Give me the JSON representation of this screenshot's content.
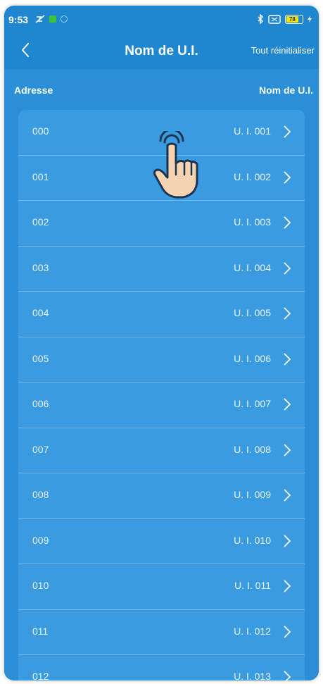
{
  "status_bar": {
    "time": "9:53",
    "battery": "78"
  },
  "header": {
    "title": "Nom de U.I.",
    "reset_label": "Tout réinitialiser"
  },
  "columns": {
    "address": "Adresse",
    "name": "Nom de U.I."
  },
  "rows": [
    {
      "address": "000",
      "name": "U. I. 001"
    },
    {
      "address": "001",
      "name": "U. I. 002"
    },
    {
      "address": "002",
      "name": "U. I. 003"
    },
    {
      "address": "003",
      "name": "U. I. 004"
    },
    {
      "address": "004",
      "name": "U. I. 005"
    },
    {
      "address": "005",
      "name": "U. I. 006"
    },
    {
      "address": "006",
      "name": "U. I. 007"
    },
    {
      "address": "007",
      "name": "U. I. 008"
    },
    {
      "address": "008",
      "name": "U. I. 009"
    },
    {
      "address": "009",
      "name": "U. I. 010"
    },
    {
      "address": "010",
      "name": "U. I. 011"
    },
    {
      "address": "011",
      "name": "U. I. 012"
    },
    {
      "address": "012",
      "name": "U. I. 013"
    }
  ],
  "colors": {
    "background": "#1f87cf",
    "list": "#3b9be0"
  },
  "icons": {
    "back": "chevron-left-icon",
    "row_arrow": "chevron-right-icon",
    "cursor": "hand-pointer-icon"
  }
}
